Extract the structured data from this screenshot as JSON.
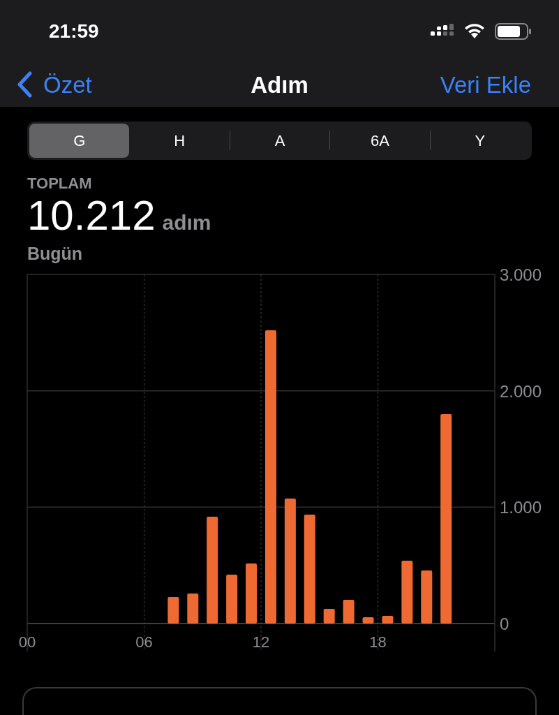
{
  "status_bar": {
    "time": "21:59"
  },
  "nav": {
    "back": "Özet",
    "title": "Adım",
    "action": "Veri Ekle"
  },
  "segments": [
    {
      "label": "G",
      "selected": true
    },
    {
      "label": "H",
      "selected": false
    },
    {
      "label": "A",
      "selected": false
    },
    {
      "label": "6A",
      "selected": false
    },
    {
      "label": "Y",
      "selected": false
    }
  ],
  "summary": {
    "label": "TOPLAM",
    "value": "10.212",
    "unit": "adım",
    "period": "Bugün"
  },
  "chart_data": {
    "type": "bar",
    "x": [
      7.5,
      8.5,
      9.5,
      10.5,
      11.5,
      12.5,
      13.5,
      14.5,
      15.5,
      16.5,
      17.5,
      18.5,
      19.5,
      20.5,
      21.5
    ],
    "xlim": [
      0,
      24
    ],
    "grid": true,
    "series": [
      {
        "color": "#ef6a32",
        "values": [
          228,
          258,
          918,
          420,
          516,
          2520,
          1074,
          936,
          126,
          204,
          54,
          66,
          540,
          456,
          1800
        ]
      }
    ],
    "ylim": [
      0,
      3000
    ],
    "yticks": [
      {
        "value": 0,
        "label": "0"
      },
      {
        "value": 1000,
        "label": "1.000"
      },
      {
        "value": 2000,
        "label": "2.000"
      },
      {
        "value": 3000,
        "label": "3.000"
      }
    ],
    "xticks": [
      {
        "value": 0,
        "label": "00"
      },
      {
        "value": 6,
        "label": "06"
      },
      {
        "value": 12,
        "label": "12"
      },
      {
        "value": 18,
        "label": "18"
      }
    ]
  }
}
